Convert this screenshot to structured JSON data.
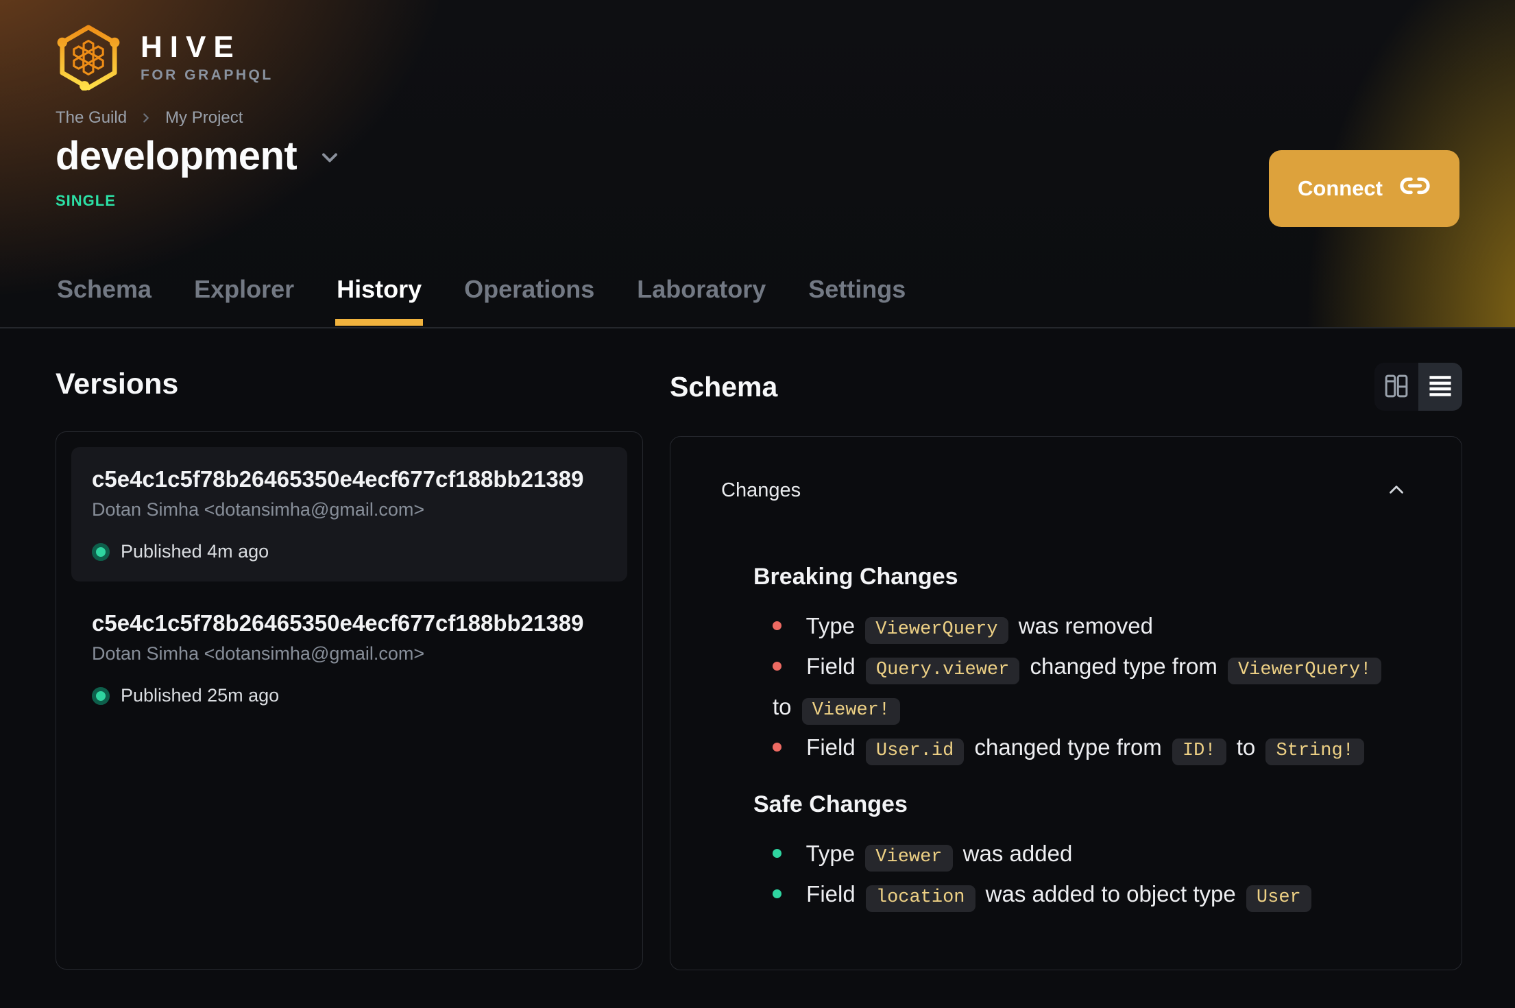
{
  "brand": {
    "name": "HIVE",
    "tagline": "FOR GRAPHQL",
    "logo_icon": "hive-honeycomb-icon"
  },
  "breadcrumb": {
    "items": [
      "The Guild",
      "My Project"
    ],
    "separator_icon": "chevron-right-icon"
  },
  "target": {
    "name": "development",
    "badge": "SINGLE",
    "caret_icon": "chevron-down-icon"
  },
  "connect": {
    "label": "Connect",
    "icon": "link-icon"
  },
  "tabs": {
    "items": [
      {
        "label": "Schema",
        "active": false
      },
      {
        "label": "Explorer",
        "active": false
      },
      {
        "label": "History",
        "active": true
      },
      {
        "label": "Operations",
        "active": false
      },
      {
        "label": "Laboratory",
        "active": false
      },
      {
        "label": "Settings",
        "active": false
      }
    ]
  },
  "versions": {
    "title": "Versions",
    "items": [
      {
        "hash": "c5e4c1c5f78b26465350e4ecf677cf188bb21389",
        "author": "Dotan Simha <dotansimha@gmail.com>",
        "status": "Published 4m ago",
        "status_icon": "published-dot-icon",
        "selected": true
      },
      {
        "hash": "c5e4c1c5f78b26465350e4ecf677cf188bb21389",
        "author": "Dotan Simha <dotansimha@gmail.com>",
        "status": "Published 25m ago",
        "status_icon": "published-dot-icon",
        "selected": false
      }
    ]
  },
  "schema": {
    "title": "Schema",
    "view_toggle": {
      "options": [
        {
          "icon": "columns-view-icon",
          "active": false
        },
        {
          "icon": "list-view-icon",
          "active": true
        }
      ]
    },
    "changes": {
      "label": "Changes",
      "collapse_icon": "chevron-up-icon",
      "groups": [
        {
          "title": "Breaking Changes",
          "severity": "breaking",
          "items": [
            {
              "segments": [
                {
                  "t": "text",
                  "v": "Type"
                },
                {
                  "t": "code",
                  "v": "ViewerQuery"
                },
                {
                  "t": "text",
                  "v": "was removed"
                }
              ]
            },
            {
              "segments": [
                {
                  "t": "text",
                  "v": "Field"
                },
                {
                  "t": "code",
                  "v": "Query.viewer"
                },
                {
                  "t": "text",
                  "v": "changed type from"
                },
                {
                  "t": "code",
                  "v": "ViewerQuery!"
                },
                {
                  "t": "break"
                },
                {
                  "t": "text",
                  "v": "to"
                },
                {
                  "t": "code",
                  "v": "Viewer!"
                }
              ]
            },
            {
              "segments": [
                {
                  "t": "text",
                  "v": "Field"
                },
                {
                  "t": "code",
                  "v": "User.id"
                },
                {
                  "t": "text",
                  "v": "changed type from"
                },
                {
                  "t": "code",
                  "v": "ID!"
                },
                {
                  "t": "text",
                  "v": "to"
                },
                {
                  "t": "code",
                  "v": "String!"
                }
              ]
            }
          ]
        },
        {
          "title": "Safe Changes",
          "severity": "safe",
          "items": [
            {
              "segments": [
                {
                  "t": "text",
                  "v": "Type"
                },
                {
                  "t": "code",
                  "v": "Viewer"
                },
                {
                  "t": "text",
                  "v": "was added"
                }
              ]
            },
            {
              "segments": [
                {
                  "t": "text",
                  "v": "Field"
                },
                {
                  "t": "code",
                  "v": "location"
                },
                {
                  "t": "text",
                  "v": "was added to object type"
                },
                {
                  "t": "code",
                  "v": "User"
                }
              ]
            }
          ]
        }
      ]
    }
  },
  "colors": {
    "accent_yellow": "#f1b33e",
    "connect_button": "#dda23c",
    "badge_green": "#2ce0a6",
    "breaking_bullet": "#ed6a62",
    "safe_bullet": "#2fd5a0",
    "code_text": "#eed185",
    "code_background": "#26272c",
    "panel_border": "#26282e",
    "page_background": "#0b0c0f"
  }
}
